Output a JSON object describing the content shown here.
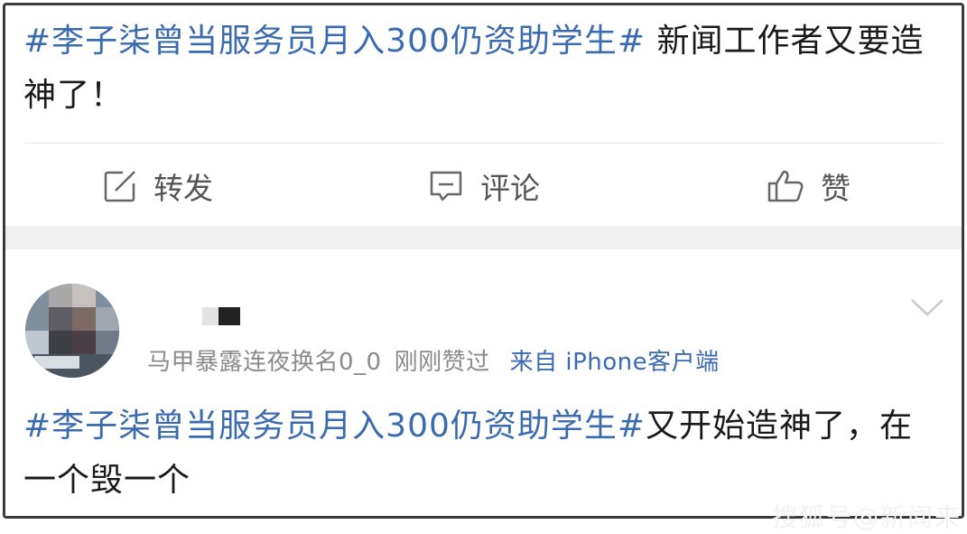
{
  "post": {
    "topic": "#李子柒曾当服务员月入300仍资助学生#",
    "text": " 新闻工作者又要造神了！"
  },
  "actions": {
    "repost_label": "转发",
    "comment_label": "评论",
    "like_label": "赞"
  },
  "comment": {
    "username": "",
    "meta_text": "马甲暴露连夜换名0_0",
    "timestamp": "刚刚赞过",
    "client": "来自 iPhone客户端",
    "topic": "#李子柒曾当服务员月入300仍资助学生#",
    "text": "又开始造神了，在一个毁一个"
  },
  "icons": {
    "repost": "repost-icon",
    "comment": "comment-icon",
    "like": "thumbs-up-icon",
    "more": "chevron-down-icon"
  },
  "colors": {
    "topic": "#3a6bb0",
    "meta": "#8a8a8a",
    "separator_band": "#f0f0f0"
  },
  "watermark": "搜狐号@新闻来"
}
